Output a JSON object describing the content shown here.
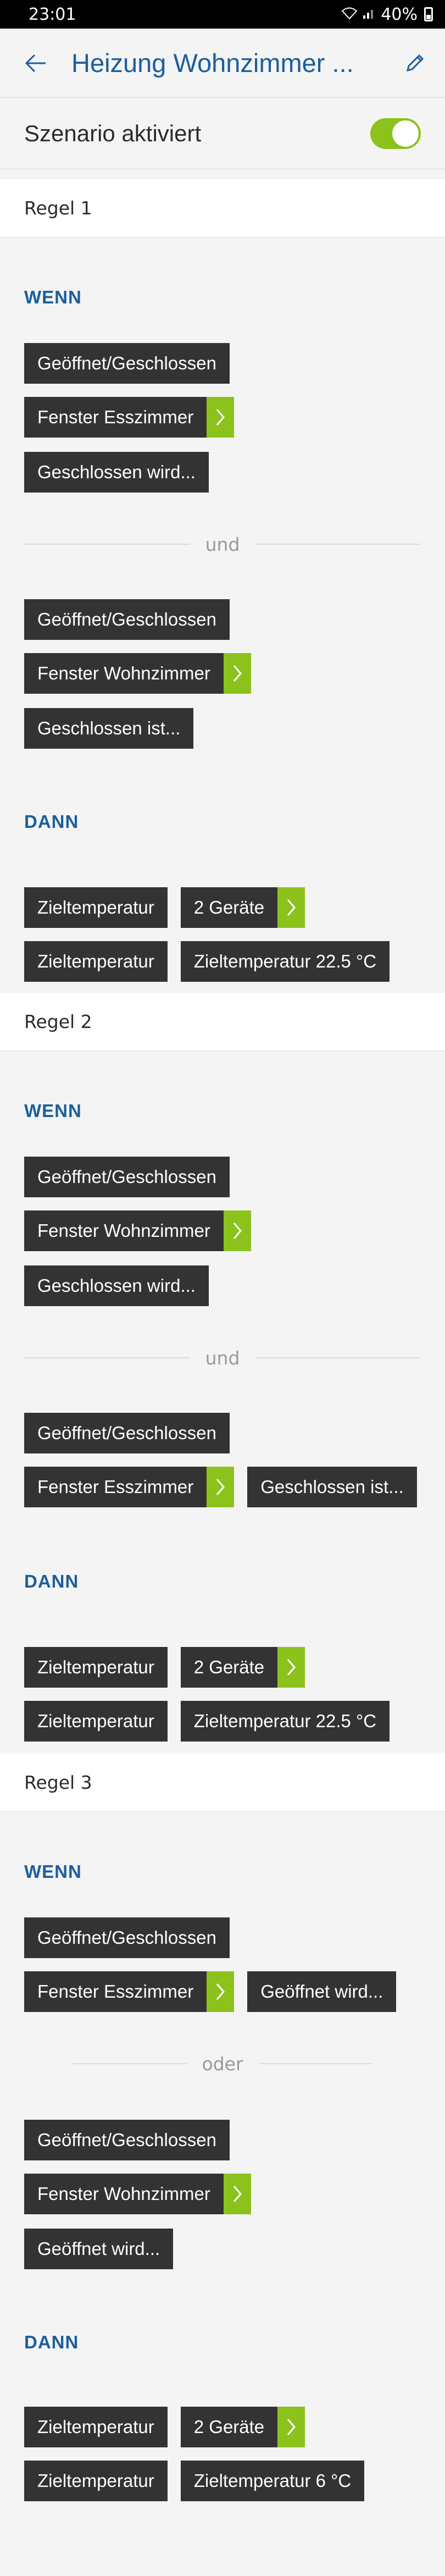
{
  "status_bar": {
    "time": "23:01",
    "battery": "40%"
  },
  "app_bar": {
    "title": "Heizung Wohnzimmer ..."
  },
  "scenario": {
    "label": "Szenario aktiviert",
    "enabled": true
  },
  "rules": [
    {
      "title": "Regel 1",
      "wenn_label": "WENN",
      "dann_label": "DANN",
      "conditions": [
        {
          "type": "Geöffnet/Geschlossen",
          "device": "Fenster Esszimmer",
          "state": "Geschlossen wird..."
        },
        {
          "type": "Geöffnet/Geschlossen",
          "device": "Fenster Wohnzimmer",
          "state": "Geschlossen ist..."
        }
      ],
      "connector": "und",
      "actions": [
        {
          "type": "Zieltemperatur",
          "target": "2 Geräte"
        },
        {
          "type": "Zieltemperatur",
          "target": "Zieltemperatur 22.5 °C"
        }
      ]
    },
    {
      "title": "Regel 2",
      "wenn_label": "WENN",
      "dann_label": "DANN",
      "conditions": [
        {
          "type": "Geöffnet/Geschlossen",
          "device": "Fenster Wohnzimmer",
          "state": "Geschlossen wird..."
        },
        {
          "type": "Geöffnet/Geschlossen",
          "device": "Fenster Esszimmer",
          "state": "Geschlossen ist..."
        }
      ],
      "connector": "und",
      "actions": [
        {
          "type": "Zieltemperatur",
          "target": "2 Geräte"
        },
        {
          "type": "Zieltemperatur",
          "target": "Zieltemperatur 22.5 °C"
        }
      ]
    },
    {
      "title": "Regel 3",
      "wenn_label": "WENN",
      "dann_label": "DANN",
      "conditions": [
        {
          "type": "Geöffnet/Geschlossen",
          "device": "Fenster Esszimmer",
          "state": "Geöffnet wird..."
        },
        {
          "type": "Geöffnet/Geschlossen",
          "device": "Fenster Wohnzimmer",
          "state": "Geöffnet wird..."
        }
      ],
      "connector": "oder",
      "actions": [
        {
          "type": "Zieltemperatur",
          "target": "2 Geräte"
        },
        {
          "type": "Zieltemperatur",
          "target": "Zieltemperatur 6 °C"
        }
      ]
    }
  ],
  "colors": {
    "accent_blue": "#1b5e9e",
    "accent_green": "#8bc21c",
    "chip_dark": "#333333",
    "background": "#f4f4f4"
  },
  "icons": {
    "back": "arrow-left-icon",
    "edit": "pencil-icon",
    "chevron": "chevron-right-icon"
  }
}
